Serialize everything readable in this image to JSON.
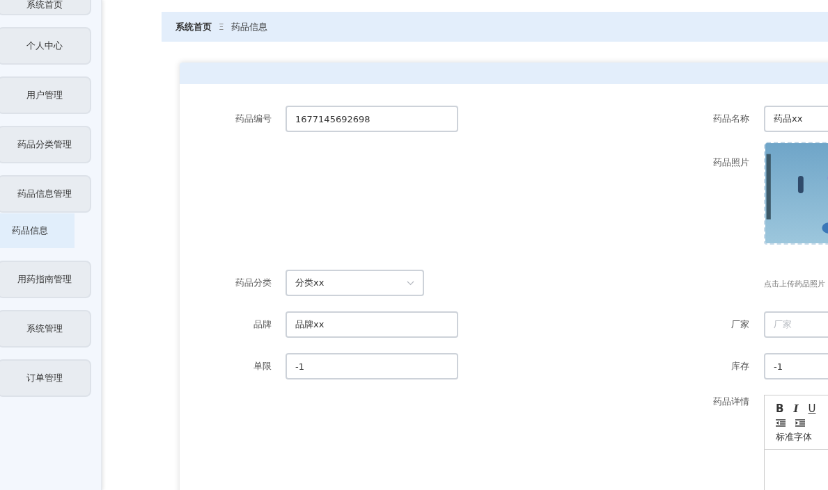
{
  "sidebar": {
    "items": [
      {
        "label": "系统首页",
        "selected": false
      },
      {
        "label": "个人中心",
        "selected": false
      },
      {
        "label": "用户管理",
        "selected": false
      },
      {
        "label": "药品分类管理",
        "selected": false
      },
      {
        "label": "药品信息管理",
        "selected": false,
        "expanded": true,
        "children": [
          {
            "label": "药品信息",
            "selected": true
          }
        ]
      },
      {
        "label": "用药指南管理",
        "selected": false
      },
      {
        "label": "系统管理",
        "selected": false
      },
      {
        "label": "订单管理",
        "selected": false
      }
    ]
  },
  "breadcrumb": {
    "items": [
      "系统首页",
      "药品信息"
    ],
    "separator": "Ξ"
  },
  "form": {
    "rows": [
      {
        "left": {
          "kind": "text",
          "label": "药品编号",
          "value": "1677145692698"
        },
        "right": {
          "kind": "text",
          "label": "药品名称",
          "value": "药品xx"
        }
      },
      {
        "left": {
          "kind": "select",
          "label": "药品分类",
          "value": "分类xx"
        },
        "right": {
          "kind": "upload",
          "label": "药品照片",
          "hint": "点击上传药品照片"
        }
      },
      {
        "left": {
          "kind": "text",
          "label": "品牌",
          "value": "品牌xx"
        },
        "right": {
          "kind": "text",
          "label": "厂家",
          "placeholder": "厂家"
        }
      },
      {
        "left": {
          "kind": "text",
          "label": "单限",
          "value": "-1"
        },
        "right": {
          "kind": "text",
          "label": "库存",
          "value": "-1"
        }
      },
      {
        "right": {
          "kind": "editor",
          "label": "药品详情",
          "buttons": [
            "B",
            "I",
            "U"
          ],
          "font": "标准字体"
        }
      }
    ]
  }
}
